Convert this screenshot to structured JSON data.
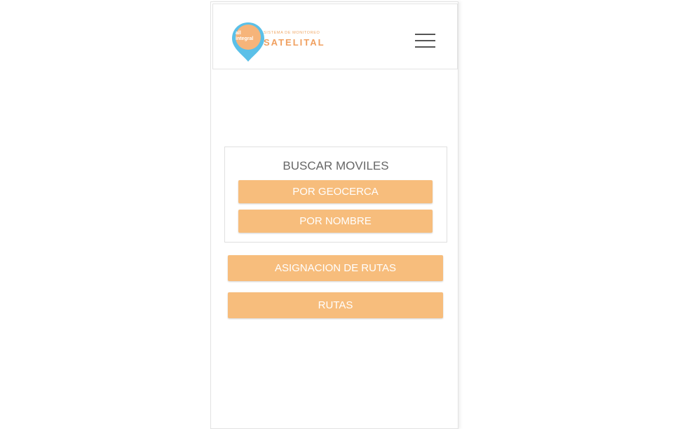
{
  "header": {
    "logo": {
      "pin_text": "all integral",
      "subtitle": "SISTEMA DE MONITOREO",
      "title": "SATELITAL"
    },
    "menu_icon": "hamburger-menu-icon"
  },
  "search_panel": {
    "title": "BUSCAR MOVILES",
    "buttons": [
      "POR GEOCERCA",
      "POR NOMBRE"
    ]
  },
  "actions": {
    "assign_routes": "ASIGNACION DE RUTAS",
    "routes": "RUTAS"
  },
  "colors": {
    "accent": "#f7bd7c",
    "pin_blue": "#5bc0e8",
    "pin_orange": "#f6b47a"
  }
}
